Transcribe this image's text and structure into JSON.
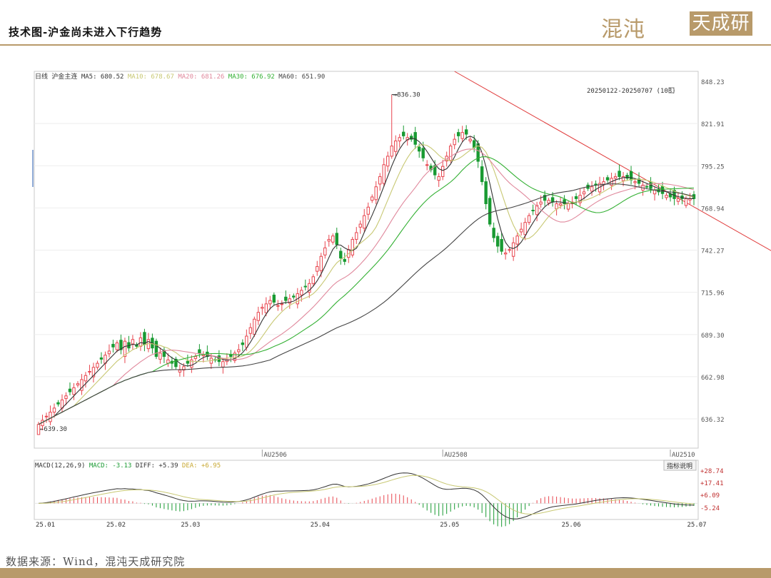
{
  "header": {
    "title": "技术图-沪金尚未进入下行趋势",
    "logo_script": "混沌",
    "logo_boxed": "天成研究院"
  },
  "footer": {
    "source": "数据来源：Wind，混沌天成研究院"
  },
  "colors": {
    "accent": "#b89a6a",
    "up": "#e8464f",
    "down": "#199a32",
    "ma5": "#333333",
    "ma10": "#c8c873",
    "ma20": "#e0889c",
    "ma30": "#33b033",
    "ma60": "#444444",
    "trendline": "#e03a3a"
  },
  "chart_data": {
    "type": "candlestick",
    "period_label": "日线",
    "instrument": "沪金主连",
    "ma_legend": [
      {
        "name": "MA5:",
        "value": "680.52"
      },
      {
        "name": "MA10:",
        "value": "678.67"
      },
      {
        "name": "MA20:",
        "value": "681.26"
      },
      {
        "name": "MA30:",
        "value": "676.92"
      },
      {
        "name": "MA60:",
        "value": "651.90"
      }
    ],
    "range_label": "20250122-20250707 (108)",
    "y_ticks": [
      "848.23",
      "821.91",
      "795.25",
      "768.94",
      "742.27",
      "715.96",
      "689.30",
      "662.98",
      "636.32"
    ],
    "ylim": [
      628,
      850
    ],
    "x_ticks": [
      "25.01",
      "25.02",
      "25.03",
      "25.04",
      "25.05",
      "25.06",
      "25.07"
    ],
    "x_tick_index": [
      0,
      18,
      37,
      70,
      103,
      134,
      166
    ],
    "contract_marks": [
      "AU2506",
      "AU2508",
      "AU2510"
    ],
    "contract_index": [
      57,
      103,
      161
    ],
    "high_annotation": {
      "index": 90,
      "value": 836.3,
      "label": "836.30"
    },
    "low_annotation": {
      "index": 0,
      "value": 639.3,
      "label": "639.30"
    },
    "trendline": {
      "x": [
        106,
        190
      ],
      "y": [
        850,
        740
      ]
    },
    "closes": [
      642.0,
      644.4,
      646.8,
      649.2,
      651.6,
      654.0,
      656.4,
      658.8,
      661.2,
      663.6,
      666.0,
      668.4,
      670.8,
      673.2,
      675.6,
      678.0,
      680.4,
      682.8,
      685.2,
      687.6,
      690.0,
      686.0,
      691.0,
      687.0,
      692.0,
      688.0,
      693.0,
      689.0,
      692.0,
      687.0,
      682.0,
      684.0,
      682.0,
      680.0,
      678.0,
      676.0,
      674.0,
      676.0,
      678.0,
      680.0,
      682.0,
      684.0,
      683.0,
      682.0,
      681.0,
      680.0,
      679.0,
      679.0,
      680.0,
      682.0,
      684.0,
      686.0,
      689.0,
      694.0,
      699.0,
      704.0,
      708.0,
      711.0,
      713.0,
      715.0,
      714.0,
      712.0,
      713.0,
      715.0,
      716.0,
      717.0,
      719.0,
      721.0,
      723.0,
      725.0,
      729.0,
      735.0,
      741.0,
      746.0,
      751.0,
      753.0,
      748.0,
      740.0,
      738.0,
      745.0,
      751.0,
      755.0,
      760.0,
      765.0,
      770.0,
      776.0,
      782.0,
      788.0,
      795.0,
      800.0,
      806.0,
      809.0,
      811.0,
      812.0,
      811.0,
      810.0,
      807.0,
      803.0,
      799.0,
      795.0,
      792.0,
      789.0,
      788.0,
      794.0,
      800.0,
      806.0,
      810.0,
      812.0,
      814.0,
      813.0,
      810.0,
      805.0,
      797.0,
      785.0,
      772.0,
      760.0,
      752.0,
      747.0,
      744.0,
      743.0,
      745.0,
      749.0,
      753.0,
      757.0,
      761.0,
      765.0,
      768.0,
      771.0,
      773.0,
      774.0,
      774.0,
      773.0,
      772.0,
      772.0,
      772.0,
      772.0,
      773.0,
      775.0,
      777.0,
      779.0,
      781.0,
      782.0,
      783.0,
      784.0,
      785.0,
      786.0,
      787.0,
      788.0,
      788.0,
      788.0,
      787.0,
      786.0,
      785.0,
      784.0,
      783.0,
      782.0,
      781.0,
      780.0,
      779.0,
      778.0,
      777.0,
      776.0,
      775.0,
      775.0,
      775.0,
      775.0,
      775.0,
      775.0
    ],
    "macd_label": "MACD(12,26,9)",
    "macd_legend": [
      {
        "name": "MACD:",
        "value": "-3.13"
      },
      {
        "name": "DIFF:",
        "value": "+5.39"
      },
      {
        "name": "DEA:",
        "value": "+6.95"
      }
    ],
    "macd_y_ticks": [
      "+28.74",
      "+17.41",
      "+6.09",
      "-5.24"
    ],
    "macd_ylim": [
      -12,
      32
    ],
    "macd_button": "指标说明"
  }
}
